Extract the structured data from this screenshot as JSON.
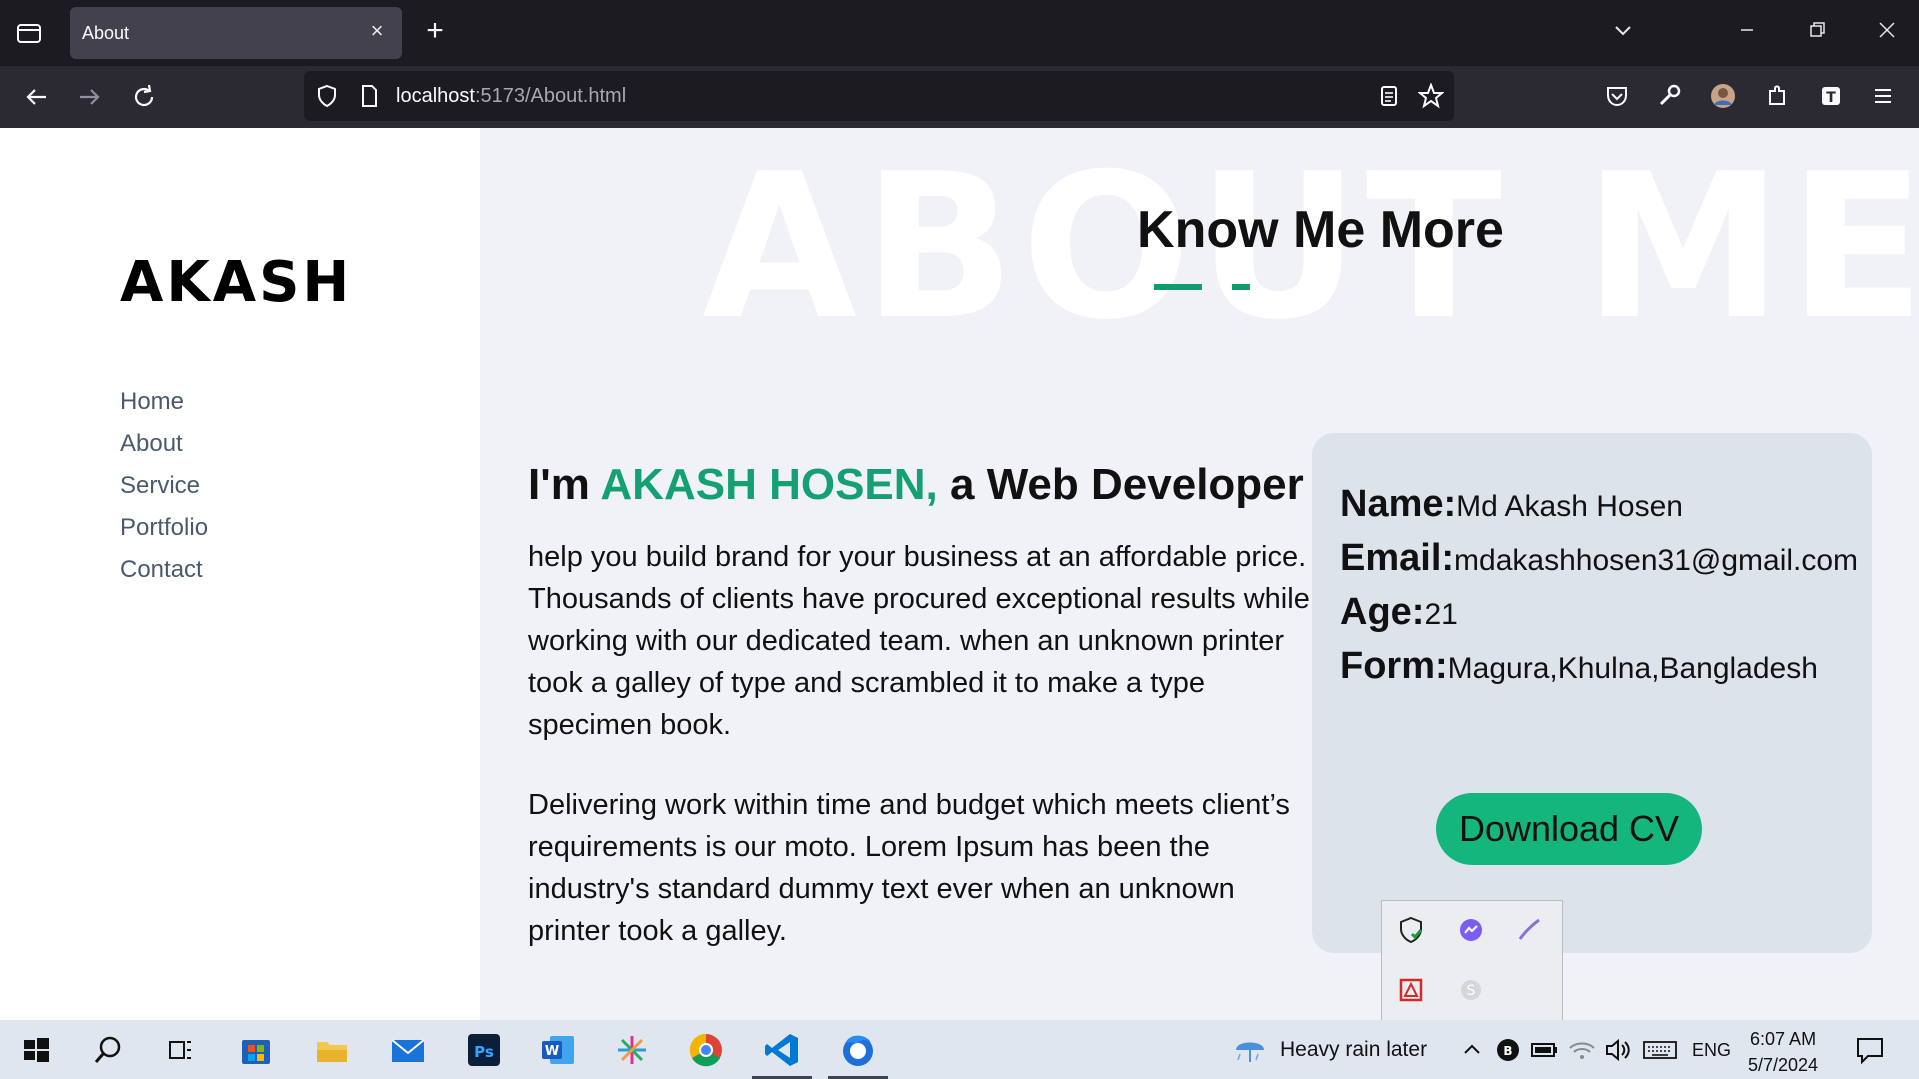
{
  "browser": {
    "tab_title": "About",
    "url_host": "localhost",
    "url_rest": ":5173/About.html"
  },
  "site": {
    "brand": "AKASH",
    "nav": [
      "Home",
      "About",
      "Service",
      "Portfolio",
      "Contact"
    ]
  },
  "about": {
    "background_word": "ABOUT ME",
    "section_title": "Know Me More",
    "headline_prefix": "I'm ",
    "headline_name": "AKASH HOSEN,",
    "headline_suffix": " a Web Developer",
    "paragraph1": "help you build brand for your business at an affordable price. Thousands of clients have procured exceptional results while working with our dedicated team. when an unknown printer took a galley of type and scrambled it to make a type specimen book.",
    "paragraph2": "Delivering work within time and budget which meets client’s requirements is our moto. Lorem Ipsum has been the industry's standard dummy text ever when an unknown printer took a galley.",
    "info": {
      "name_label": "Name:",
      "name_value": "Md Akash Hosen",
      "email_label": "Email:",
      "email_value": "mdakashhosen31@gmail.com",
      "age_label": "Age:",
      "age_value": "21",
      "from_label": "Form:",
      "from_value": "Magura,Khulna,Bangladesh"
    },
    "download_button": "Download CV"
  },
  "taskbar": {
    "weather": "Heavy rain later",
    "language": "ENG",
    "time": "6:07 AM",
    "date": "5/7/2024"
  },
  "colors": {
    "accent": "#14a072",
    "button": "#15b57e",
    "card": "#dde3eb"
  }
}
